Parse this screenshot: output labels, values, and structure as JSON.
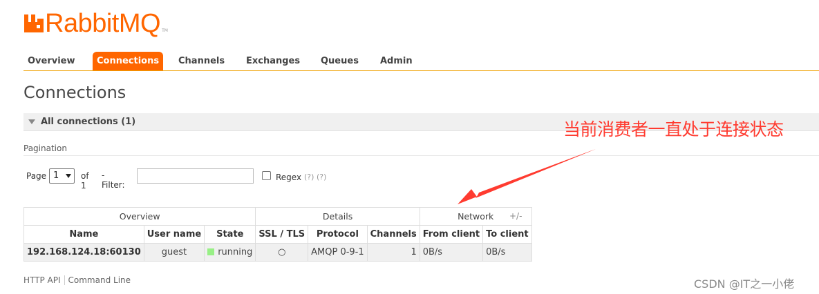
{
  "brand": {
    "name": "RabbitMQ",
    "tm": "TM"
  },
  "nav": {
    "items": [
      "Overview",
      "Connections",
      "Channels",
      "Exchanges",
      "Queues",
      "Admin"
    ],
    "active": "Connections"
  },
  "page": {
    "title": "Connections"
  },
  "section": {
    "label": "All connections (1)"
  },
  "pagination": {
    "label": "Pagination",
    "page_label": "Page",
    "page_value": "1",
    "of_label": "of 1",
    "filter_label": "- Filter:",
    "filter_value": "",
    "regex_label": "Regex",
    "help1": "(?)",
    "help2": "(?)"
  },
  "table": {
    "groups": [
      "Overview",
      "Details",
      "Network"
    ],
    "plus_minus": "+/-",
    "columns": [
      "Name",
      "User name",
      "State",
      "SSL / TLS",
      "Protocol",
      "Channels",
      "From client",
      "To client"
    ],
    "rows": [
      {
        "name": "192.168.124.18:60130",
        "user": "guest",
        "state": "running",
        "ssl": "○",
        "protocol": "AMQP 0-9-1",
        "channels": "1",
        "from_client": "0B/s",
        "to_client": "0B/s"
      }
    ]
  },
  "footer": {
    "http_api": "HTTP API",
    "command_line": "Command Line"
  },
  "annotation": {
    "text": "当前消费者一直处于连接状态"
  },
  "watermark": "CSDN @IT之一小佬",
  "colors": {
    "brand": "#ff6600",
    "annotation": "#ff3b30",
    "running": "#98f086"
  }
}
